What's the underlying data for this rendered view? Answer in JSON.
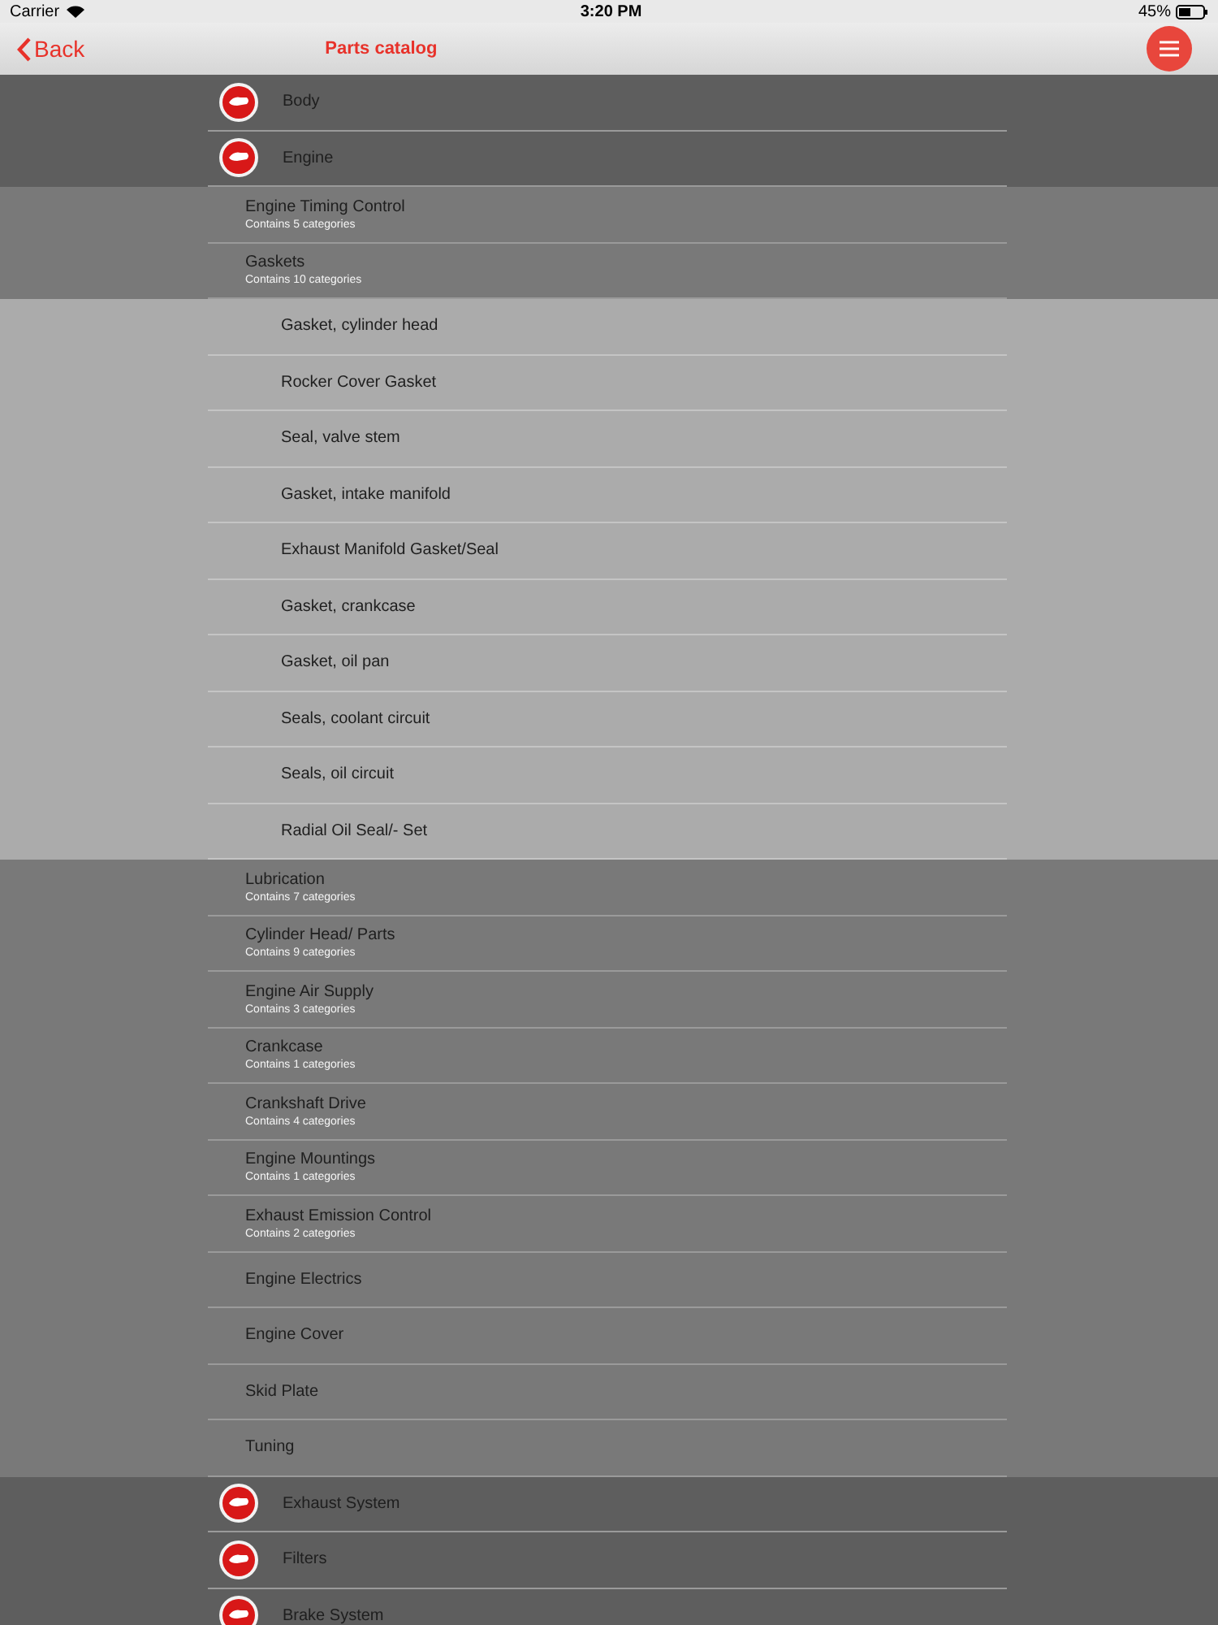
{
  "status_bar": {
    "carrier": "Carrier",
    "time": "3:20 PM",
    "battery": "45%"
  },
  "nav": {
    "back": "Back",
    "title": "Parts catalog"
  },
  "categories": [
    {
      "name": "Body"
    },
    {
      "name": "Engine",
      "children": [
        {
          "name": "Engine Timing Control",
          "subtitle": "Contains 5 categories"
        },
        {
          "name": "Gaskets",
          "subtitle": "Contains 10 categories",
          "children": [
            {
              "name": "Gasket, cylinder head"
            },
            {
              "name": "Rocker Cover Gasket"
            },
            {
              "name": "Seal, valve stem"
            },
            {
              "name": "Gasket, intake manifold"
            },
            {
              "name": "Exhaust Manifold Gasket/Seal"
            },
            {
              "name": "Gasket, crankcase"
            },
            {
              "name": "Gasket, oil pan"
            },
            {
              "name": "Seals, coolant circuit"
            },
            {
              "name": "Seals, oil circuit"
            },
            {
              "name": "Radial Oil Seal/- Set"
            }
          ]
        },
        {
          "name": "Lubrication",
          "subtitle": "Contains 7 categories"
        },
        {
          "name": "Cylinder Head/ Parts",
          "subtitle": "Contains 9 categories"
        },
        {
          "name": "Engine Air Supply",
          "subtitle": "Contains 3 categories"
        },
        {
          "name": "Crankcase",
          "subtitle": "Contains 1 categories"
        },
        {
          "name": "Crankshaft Drive",
          "subtitle": "Contains 4 categories"
        },
        {
          "name": "Engine Mountings",
          "subtitle": "Contains 1 categories"
        },
        {
          "name": "Exhaust Emission Control",
          "subtitle": "Contains 2 categories"
        },
        {
          "name": "Engine Electrics"
        },
        {
          "name": "Engine Cover"
        },
        {
          "name": "Skid Plate"
        },
        {
          "name": "Tuning"
        }
      ]
    },
    {
      "name": "Exhaust System"
    },
    {
      "name": "Filters"
    },
    {
      "name": "Brake System"
    }
  ]
}
